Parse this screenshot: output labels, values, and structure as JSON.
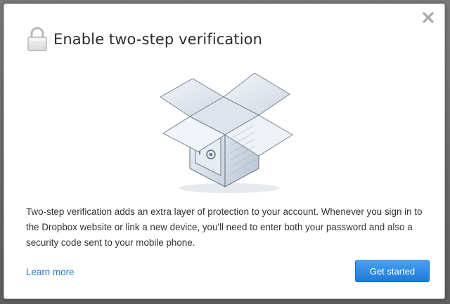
{
  "dialog": {
    "title": "Enable two-step verification",
    "description": "Two-step verification adds an extra layer of protection to your account. Whenever you sign in to the Dropbox website or link a new device, you'll need to enter both your password and also a security code sent to your mobile phone.",
    "learn_more_label": "Learn more",
    "primary_button_label": "Get started",
    "icons": {
      "close": "close-icon",
      "header": "lock-icon",
      "illustration": "open-box-safe-illustration"
    }
  },
  "colors": {
    "link": "#2b7bc4",
    "button": "#1c7ad8",
    "title": "#2b2b2b",
    "text": "#333333"
  }
}
